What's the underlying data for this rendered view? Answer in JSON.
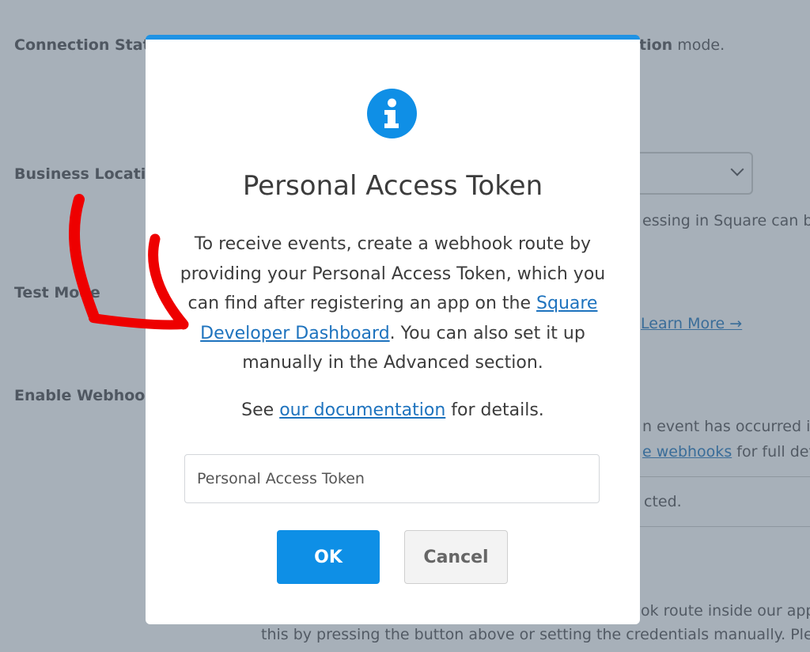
{
  "background": {
    "connection_status_label": "Connection Statu",
    "connection_status_suffix_bold": "tion",
    "connection_status_suffix": " mode.",
    "business_location_label": "Business Location",
    "business_location_help": "essing in Square can b",
    "test_mode_label": "Test Mode",
    "learn_more_link": "Learn More →",
    "enable_webhooks_label": "Enable Webhook",
    "webhooks_help_1": "n event has occurred i",
    "webhooks_help_link": "e webhooks",
    "webhooks_help_2": " for full det",
    "field_text": "cted.",
    "bottom_line_1": "ok route inside our app",
    "bottom_line_2": "this by pressing the button above or setting the credentials manually. Ple"
  },
  "modal": {
    "icon": "info-icon",
    "title": "Personal Access Token",
    "body_part1": "To receive events, create a webhook route by providing your Personal Access Token, which you can find after registering an app on the ",
    "body_link": "Square Developer Dashboard",
    "body_part2": ". You can also set it up manually in the Advanced section.",
    "note_prefix": "See ",
    "note_link": "our documentation",
    "note_suffix": " for details.",
    "input_placeholder": "Personal Access Token",
    "input_value": "",
    "ok_label": "OK",
    "cancel_label": "Cancel"
  },
  "colors": {
    "overlay": "#a7b0b9",
    "modal_accent": "#1f93e4",
    "ok_button": "#0e8fe6",
    "link": "#1e73be",
    "annotation_arrow": "#ee0000"
  }
}
